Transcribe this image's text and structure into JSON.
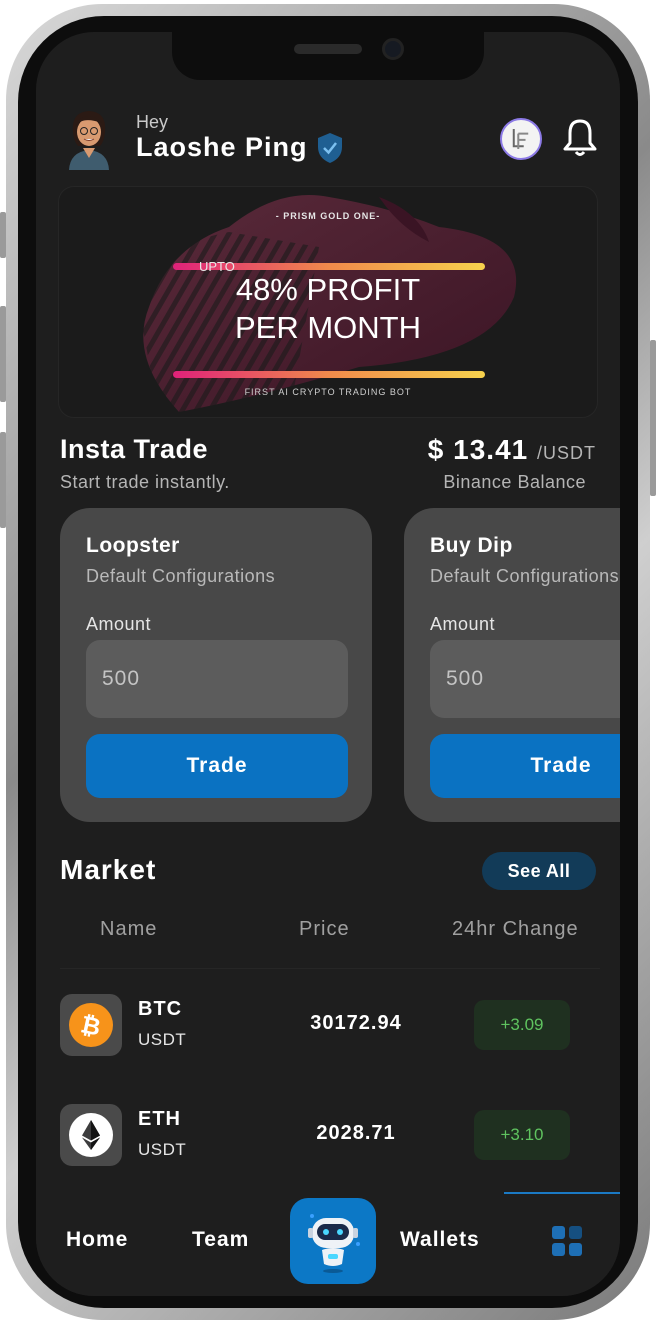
{
  "header": {
    "greeting": "Hey",
    "username": "Laoshe Ping"
  },
  "banner": {
    "top_text": "- PRISM GOLD ONE-",
    "upto": "UPTO",
    "line1": "48% PROFIT",
    "line2": "PER MONTH",
    "footer": "FIRST AI CRYPTO TRADING BOT"
  },
  "insta_trade": {
    "title": "Insta Trade",
    "subtitle": "Start trade instantly.",
    "balance": "$ 13.41",
    "balance_unit": "/USDT",
    "balance_label": "Binance Balance"
  },
  "cards": [
    {
      "name": "Loopster",
      "subtitle": "Default Configurations",
      "amount_label": "Amount",
      "amount_value": "500",
      "button": "Trade"
    },
    {
      "name": "Buy Dip",
      "subtitle": "Default Configurations",
      "amount_label": "Amount",
      "amount_value": "500",
      "button": "Trade"
    }
  ],
  "market": {
    "title": "Market",
    "see_all": "See All",
    "columns": [
      "Name",
      "Price",
      "24hr Change"
    ],
    "rows": [
      {
        "symbol": "BTC",
        "quote": "USDT",
        "price": "30172.94",
        "change": "+3.09",
        "icon": "bitcoin-icon"
      },
      {
        "symbol": "ETH",
        "quote": "USDT",
        "price": "2028.71",
        "change": "+3.10",
        "icon": "ethereum-icon"
      }
    ]
  },
  "nav": {
    "home": "Home",
    "team": "Team",
    "wallets": "Wallets"
  },
  "colors": {
    "background": "#1e1e1e",
    "card": "#484848",
    "accent": "#0a72c2",
    "positive": "#5fc35f"
  }
}
